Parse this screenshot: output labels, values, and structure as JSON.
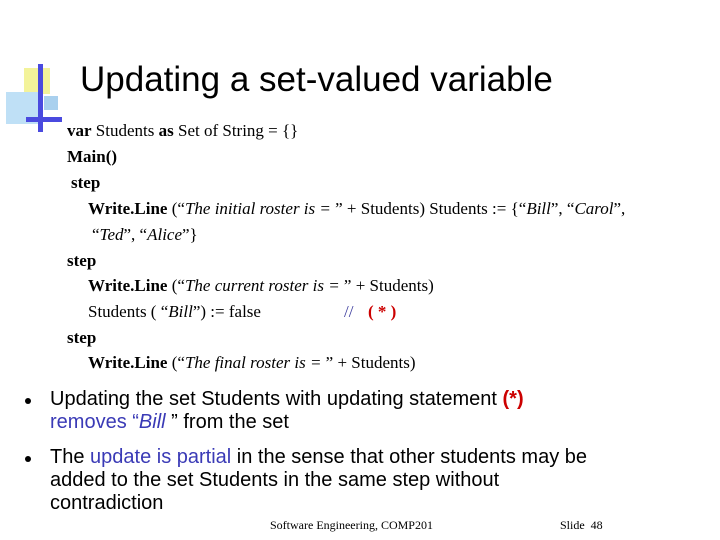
{
  "slide": {
    "title": "Updating a set-valued variable",
    "code": {
      "l1_kw1": "var",
      "l1_a": " Students ",
      "l1_kw2": "as",
      "l1_b": " Set of String = {}",
      "l2": "Main()",
      "l3": "step",
      "l4_a": "Write.Line (“",
      "l4_i": "The initial roster is = ",
      "l4_b": "” + Students) Students := {“",
      "l4_i2": "Bill",
      "l4_c": "”, “",
      "l4_i3": "Carol",
      "l4_d": "”,",
      "l5_a": "“",
      "l5_i1": "Ted",
      "l5_b": "”, “",
      "l5_i2": "Alice",
      "l5_c": "”}",
      "l6": "step",
      "l7_a": "Write.Line (“",
      "l7_i": "The current roster is = ",
      "l7_b": "” + Students)",
      "l8_a": "Students ( “",
      "l8_i": "Bill",
      "l8_b": "”) := false",
      "l8_comment": "//",
      "l8_mark": "( * )",
      "l9": "step",
      "l10_a": "Write.Line (“",
      "l10_i": "The final roster is = ",
      "l10_b": "” + Students)"
    },
    "bullets": {
      "b1_a": "Updating the set Students with updating statement ",
      "b1_mark": "(*)",
      "b1_b": "removes “",
      "b1_i": "Bill",
      "b1_c": " ” from the set",
      "b2_a": "The ",
      "b2_hl": "update is partial",
      "b2_b": " in the sense that other students may be",
      "b2_c": "added to the set Students in the same step without",
      "b2_d": "contradiction"
    },
    "footer": {
      "course": "Software Engineering, COMP201",
      "slide_label": "Slide",
      "slide_number": "48"
    }
  }
}
